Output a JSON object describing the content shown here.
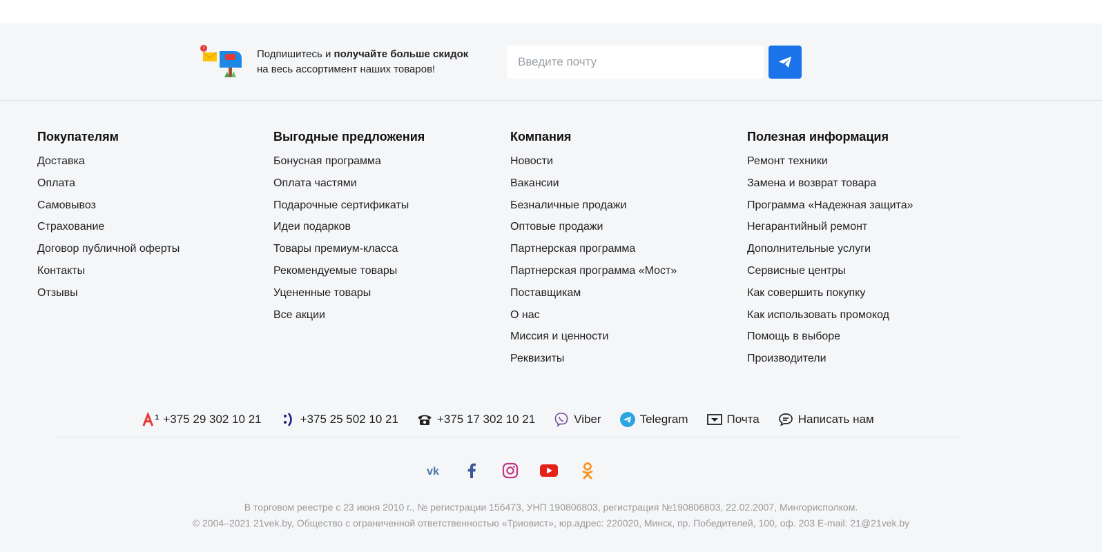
{
  "subscribe": {
    "text_prefix": "Подпишитесь и ",
    "text_bold": "получайте больше скидок",
    "text_line2": "на весь ассортимент наших товаров!",
    "input_placeholder": "Введите почту",
    "send_icon": "paper-plane-icon",
    "accent_color": "#1a73e8"
  },
  "columns": [
    {
      "title": "Покупателям",
      "items": [
        "Доставка",
        "Оплата",
        "Самовывоз",
        "Страхование",
        "Договор публичной оферты",
        "Контакты",
        "Отзывы"
      ]
    },
    {
      "title": "Выгодные предложения",
      "items": [
        "Бонусная программа",
        "Оплата частями",
        "Подарочные сертификаты",
        "Идеи подарков",
        "Товары премиум-класса",
        "Рекомендуемые товары",
        "Уцененные товары",
        "Все акции"
      ]
    },
    {
      "title": "Компания",
      "items": [
        "Новости",
        "Вакансии",
        "Безналичные продажи",
        "Оптовые продажи",
        "Партнерская программа",
        "Партнерская программа «Мост»",
        "Поставщикам",
        "О нас",
        "Миссия и ценности",
        "Реквизиты"
      ]
    },
    {
      "title": "Полезная информация",
      "items": [
        "Ремонт техники",
        "Замена и возврат товара",
        "Программа «Надежная защита»",
        "Негарантийный ремонт",
        "Дополнительные услуги",
        "Сервисные центры",
        "Как совершить покупку",
        "Как использовать промокод",
        "Помощь в выборе",
        "Производители"
      ]
    }
  ],
  "contacts": [
    {
      "icon": "a1-operator-icon",
      "label": "+375 29 302 10 21"
    },
    {
      "icon": "life-operator-icon",
      "label": "+375 25 502 10 21"
    },
    {
      "icon": "landline-phone-icon",
      "label": "+375 17 302 10 21"
    },
    {
      "icon": "viber-icon",
      "label": "Viber"
    },
    {
      "icon": "telegram-icon",
      "label": "Telegram"
    },
    {
      "icon": "mail-icon",
      "label": "Почта"
    },
    {
      "icon": "chat-icon",
      "label": "Написать нам"
    }
  ],
  "social": [
    {
      "icon": "vk-icon",
      "color": "#4a76a8"
    },
    {
      "icon": "facebook-icon",
      "color": "#3b5998"
    },
    {
      "icon": "instagram-icon",
      "color": "#c13584"
    },
    {
      "icon": "youtube-icon",
      "color": "#e62117"
    },
    {
      "icon": "odnoklassniki-icon",
      "color": "#f7931e"
    }
  ],
  "legal": {
    "line1": "В торговом реестре с 23 июня 2010 г., № регистрации 156473, УНП 190806803, регистрация №190806803, 22.02.2007, Мингорисполком.",
    "line2": "© 2004–2021 21vek.by, Общество с ограниченной ответственностью «Триовист», юр.адрес: 220020, Минск, пр. Победителей, 100, оф. 203 E-mail: 21@21vek.by"
  }
}
